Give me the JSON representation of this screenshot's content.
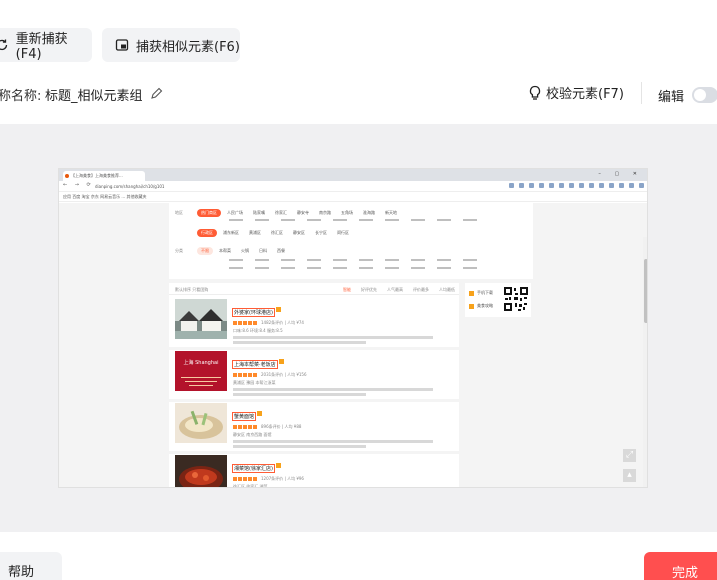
{
  "toolbar": {
    "recapture_label": "重新捕获(F4)",
    "capture_similar_label": "捕获相似元素(F6)"
  },
  "name_row": {
    "label": "称名称:",
    "value": "标题_相似元素组",
    "verify_label": "校验元素(F7)",
    "edit_label": "编辑",
    "edit_enabled": false
  },
  "preview": {
    "browser_tab_title": "【上海美食】上海美食推荐...",
    "url": "dianping.com/shanghai/ch10/g101",
    "bookmarks": "应用  百度  淘宝  京东  网易云音乐  ...  其他收藏夹",
    "filter": {
      "row1_key": "地区",
      "row1_chip": "热门商区",
      "row1_items": [
        "人民广场",
        "陆家嘴",
        "徐家汇",
        "静安寺",
        "南京路",
        "五角场",
        "淮海路",
        "新天地"
      ],
      "row2_chip": "行政区",
      "row2_items": [
        "浦东新区",
        "黄浦区",
        "徐汇区",
        "静安区",
        "长宁区",
        "闵行区"
      ],
      "row3_key": "分类",
      "row3_chip": "不限",
      "row3_items": [
        "本帮菜",
        "火锅",
        "日料",
        "西餐"
      ]
    },
    "sort": {
      "left": "默认排序   只看团购",
      "items": [
        "智能",
        "好评优先",
        "人气最高",
        "评价最多",
        "人均最低"
      ],
      "active_index": 0
    },
    "shops": [
      {
        "name": "外婆家(环球港店)",
        "meta": "1482条评价 | 人均 ¥74",
        "sub": "口味:8.6  环境:8.4  服务:8.5"
      },
      {
        "name": "上海本帮菜·老饭店",
        "meta": "2031条评价 | 人均 ¥156",
        "sub": "黄浦区 豫园 本帮江浙菜"
      },
      {
        "name": "蟹黄面馆",
        "meta": "896条评价 | 人均 ¥88",
        "sub": "静安区 南京西路 面馆"
      },
      {
        "name": "湘菜馆(徐家汇店)",
        "meta": "1207条评价 | 人均 ¥96",
        "sub": "徐汇区 徐家汇 湘菜"
      }
    ],
    "side_links": [
      "手机下载",
      "美食攻略"
    ],
    "poster_text": "上海 Shanghai"
  },
  "footer": {
    "help_label": "帮助",
    "done_label": "完成"
  },
  "colors": {
    "accent": "#ff4f4f",
    "site_orange": "#ff5c35"
  }
}
